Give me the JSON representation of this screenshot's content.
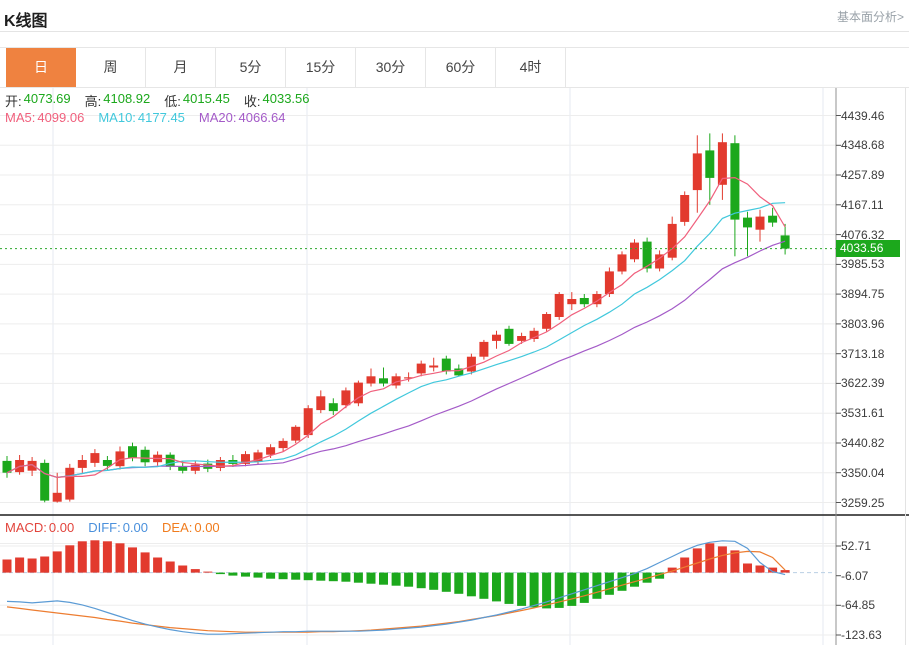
{
  "header": {
    "title": "K线图",
    "link": "基本面分析>"
  },
  "tabs": {
    "active_index": 0,
    "items": [
      "日",
      "周",
      "月",
      "5分",
      "15分",
      "30分",
      "60分",
      "4时"
    ],
    "names": [
      "day",
      "week",
      "month",
      "5min",
      "15min",
      "30min",
      "60min",
      "4hour"
    ]
  },
  "ohlc": {
    "items": [
      {
        "label": "开:",
        "value": "4073.69"
      },
      {
        "label": "高:",
        "value": "4108.92"
      },
      {
        "label": "低:",
        "value": "4015.45"
      },
      {
        "label": "收:",
        "value": "4033.56"
      }
    ]
  },
  "ma_header": {
    "items": [
      {
        "label": "MA5:",
        "value": "4099.06",
        "color": "#f0607d"
      },
      {
        "label": "MA10:",
        "value": "4177.45",
        "color": "#41c8dc"
      },
      {
        "label": "MA20:",
        "value": "4066.64",
        "color": "#a45bc8"
      }
    ]
  },
  "macd_header": {
    "items": [
      {
        "label": "MACD:",
        "value": "0.00",
        "color": "#e2443c"
      },
      {
        "label": "DIFF:",
        "value": "0.00",
        "color": "#4a90dc"
      },
      {
        "label": "DEA:",
        "value": "0.00",
        "color": "#f07c1e"
      }
    ]
  },
  "price_tag": {
    "value": "4033.56",
    "bg": "#1ca81c"
  },
  "colors": {
    "up": "#e23a2e",
    "down": "#1ca81c",
    "ohlc_value": "#1ca81c",
    "ma5": "#f0607d",
    "ma10": "#41c8dc",
    "ma20": "#a45bc8",
    "diff_line": "#5b9bd5",
    "dea_line": "#ed7d31",
    "price_line": "#2ca82c",
    "tab_active": "#ef8240",
    "grid": "#ededed",
    "vgrid": "#e6eaf2",
    "axis": "#909090",
    "divider": "#1f1f1f",
    "zero_dash": "#b9cfe4",
    "tick": "#555555"
  },
  "chart_data": [
    {
      "type": "candlestick",
      "title": "K线图 (daily candlestick with MA5/MA10/MA20)",
      "legend": [
        "MA5",
        "MA10",
        "MA20"
      ],
      "y_axis_ticks": [
        4439.46,
        4348.68,
        4257.89,
        4167.11,
        4076.32,
        3985.53,
        3894.75,
        3803.96,
        3713.18,
        3622.39,
        3531.61,
        3440.82,
        3350.04,
        3259.25
      ],
      "current_price": 4033.56,
      "ohlc": {
        "open": 4073.69,
        "high": 4108.92,
        "low": 4015.45,
        "close": 4033.56
      },
      "ma_values": {
        "MA5": 4099.06,
        "MA10": 4177.45,
        "MA20": 4066.64
      },
      "ma_periods": [
        5,
        10,
        20
      ],
      "candles": [
        [
          3386,
          3401,
          3335,
          3350
        ],
        [
          3352,
          3404,
          3344,
          3389
        ],
        [
          3356,
          3398,
          3340,
          3386
        ],
        [
          3380,
          3390,
          3260,
          3265
        ],
        [
          3262,
          3350,
          3259,
          3289
        ],
        [
          3268,
          3377,
          3262,
          3365
        ],
        [
          3365,
          3404,
          3350,
          3389
        ],
        [
          3380,
          3422,
          3368,
          3410
        ],
        [
          3389,
          3401,
          3359,
          3371
        ],
        [
          3370,
          3430,
          3360,
          3415
        ],
        [
          3431,
          3442,
          3385,
          3395
        ],
        [
          3420,
          3430,
          3370,
          3382
        ],
        [
          3382,
          3415,
          3372,
          3405
        ],
        [
          3405,
          3412,
          3358,
          3368
        ],
        [
          3370,
          3385,
          3348,
          3356
        ],
        [
          3356,
          3386,
          3346,
          3375
        ],
        [
          3378,
          3390,
          3352,
          3362
        ],
        [
          3365,
          3398,
          3355,
          3389
        ],
        [
          3389,
          3404,
          3368,
          3377
        ],
        [
          3377,
          3416,
          3370,
          3407
        ],
        [
          3383,
          3420,
          3374,
          3412
        ],
        [
          3405,
          3437,
          3395,
          3428
        ],
        [
          3425,
          3455,
          3415,
          3447
        ],
        [
          3448,
          3495,
          3440,
          3490
        ],
        [
          3465,
          3556,
          3456,
          3547
        ],
        [
          3541,
          3601,
          3532,
          3583
        ],
        [
          3562,
          3577,
          3526,
          3538
        ],
        [
          3556,
          3610,
          3547,
          3601
        ],
        [
          3562,
          3631,
          3553,
          3625
        ],
        [
          3622,
          3668,
          3613,
          3644
        ],
        [
          3638,
          3671,
          3613,
          3622
        ],
        [
          3616,
          3653,
          3607,
          3644
        ],
        [
          3638,
          3656,
          3628,
          3641
        ],
        [
          3653,
          3692,
          3644,
          3683
        ],
        [
          3671,
          3701,
          3659,
          3677
        ],
        [
          3698,
          3707,
          3650,
          3659
        ],
        [
          3668,
          3680,
          3644,
          3647
        ],
        [
          3659,
          3713,
          3650,
          3704
        ],
        [
          3704,
          3755,
          3695,
          3749
        ],
        [
          3752,
          3783,
          3728,
          3771
        ],
        [
          3789,
          3798,
          3737,
          3743
        ],
        [
          3752,
          3777,
          3743,
          3767
        ],
        [
          3758,
          3792,
          3749,
          3783
        ],
        [
          3789,
          3840,
          3780,
          3834
        ],
        [
          3825,
          3901,
          3816,
          3895
        ],
        [
          3864,
          3901,
          3846,
          3880
        ],
        [
          3883,
          3895,
          3855,
          3864
        ],
        [
          3864,
          3904,
          3855,
          3895
        ],
        [
          3895,
          3976,
          3886,
          3964
        ],
        [
          3964,
          4025,
          3955,
          4016
        ],
        [
          4001,
          4062,
          3992,
          4052
        ],
        [
          4055,
          4067,
          3961,
          3973
        ],
        [
          3973,
          4028,
          3964,
          4016
        ],
        [
          4006,
          4131,
          3998,
          4109
        ],
        [
          4115,
          4208,
          4103,
          4197
        ],
        [
          4212,
          4379,
          4143,
          4324
        ],
        [
          4333,
          4385,
          4167,
          4249
        ],
        [
          4228,
          4385,
          4182,
          4358
        ],
        [
          4355,
          4379,
          4010,
          4122
        ],
        [
          4128,
          4146,
          4010,
          4098
        ],
        [
          4091,
          4152,
          4055,
          4131
        ],
        [
          4134,
          4158,
          4100,
          4113
        ],
        [
          4073.69,
          4108.92,
          4015.45,
          4033.56
        ]
      ]
    },
    {
      "type": "bar",
      "title": "MACD",
      "y_axis_ticks": [
        52.71,
        -6.07,
        -64.85,
        -123.63
      ],
      "macd": 0.0,
      "diff": 0.0,
      "dea": 0.0,
      "hist": [
        26,
        30,
        28,
        32,
        42,
        54,
        62,
        64,
        62,
        58,
        50,
        40,
        30,
        22,
        14,
        7,
        2,
        -3,
        -6,
        -8,
        -10,
        -12,
        -13,
        -14,
        -15,
        -16,
        -17,
        -18,
        -20,
        -22,
        -24,
        -26,
        -28,
        -31,
        -34,
        -38,
        -42,
        -47,
        -52,
        -57,
        -62,
        -66,
        -69,
        -71,
        -70,
        -66,
        -60,
        -52,
        -44,
        -36,
        -28,
        -20,
        -12,
        10,
        30,
        48,
        58,
        52,
        44,
        18,
        14,
        10,
        5
      ],
      "diff_line": [
        -57,
        -58,
        -60,
        -58,
        -56,
        -59,
        -64,
        -71,
        -79,
        -87,
        -95,
        -102,
        -108,
        -113,
        -117,
        -120,
        -122,
        -122,
        -121,
        -120,
        -119,
        -118,
        -117,
        -117,
        -116,
        -116,
        -116,
        -116,
        -116,
        -115,
        -114,
        -112,
        -110,
        -108,
        -105,
        -102,
        -98,
        -94,
        -89,
        -84,
        -78,
        -72,
        -65,
        -58,
        -50,
        -42,
        -34,
        -26,
        -18,
        -10,
        -2,
        8,
        20,
        32,
        44,
        54,
        60,
        63,
        62,
        48,
        20,
        2,
        -4
      ],
      "dea_line": [
        -68,
        -71,
        -74,
        -77,
        -80,
        -83,
        -86,
        -89,
        -93,
        -96,
        -100,
        -103,
        -106,
        -109,
        -111,
        -113,
        -115,
        -116,
        -117,
        -118,
        -118,
        -118,
        -118,
        -118,
        -118,
        -117,
        -117,
        -116,
        -115,
        -114,
        -112,
        -110,
        -108,
        -106,
        -103,
        -100,
        -97,
        -93,
        -89,
        -85,
        -80,
        -75,
        -70,
        -64,
        -58,
        -52,
        -46,
        -39,
        -32,
        -25,
        -18,
        -11,
        -4,
        3,
        11,
        19,
        27,
        34,
        39,
        42,
        41,
        30,
        5
      ]
    }
  ]
}
